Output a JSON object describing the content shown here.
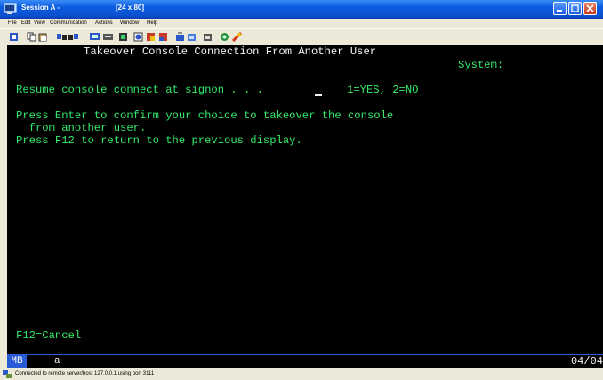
{
  "window": {
    "title": "Session A -",
    "size_label": "[24 x 80]"
  },
  "menu": [
    "File",
    "Edit",
    "View",
    "Communication",
    "Actions",
    "Window",
    "Help"
  ],
  "screen": {
    "heading": "Takeover Console Connection From Another User",
    "system_label": "System:",
    "prompt_label": "Resume console connect at signon . . .",
    "prompt_value": "_",
    "prompt_options": "1=YES, 2=NO",
    "instructions": [
      "Press Enter to confirm your choice to takeover the console",
      "  from another user.",
      "Press F12 to return to the previous display."
    ],
    "fkey_cancel": "F12=Cancel"
  },
  "oia": {
    "mode": "MB",
    "indicator": "a",
    "cursor_position": "04/04"
  },
  "status": {
    "text": "Connected to remote server/host 127.0.0.1 using port 3111"
  },
  "colors": {
    "screen_bg": "#000000",
    "field_text": "#34e86a",
    "heading_text": "#f2f2f2",
    "titlebar": "#0a5ae0"
  }
}
